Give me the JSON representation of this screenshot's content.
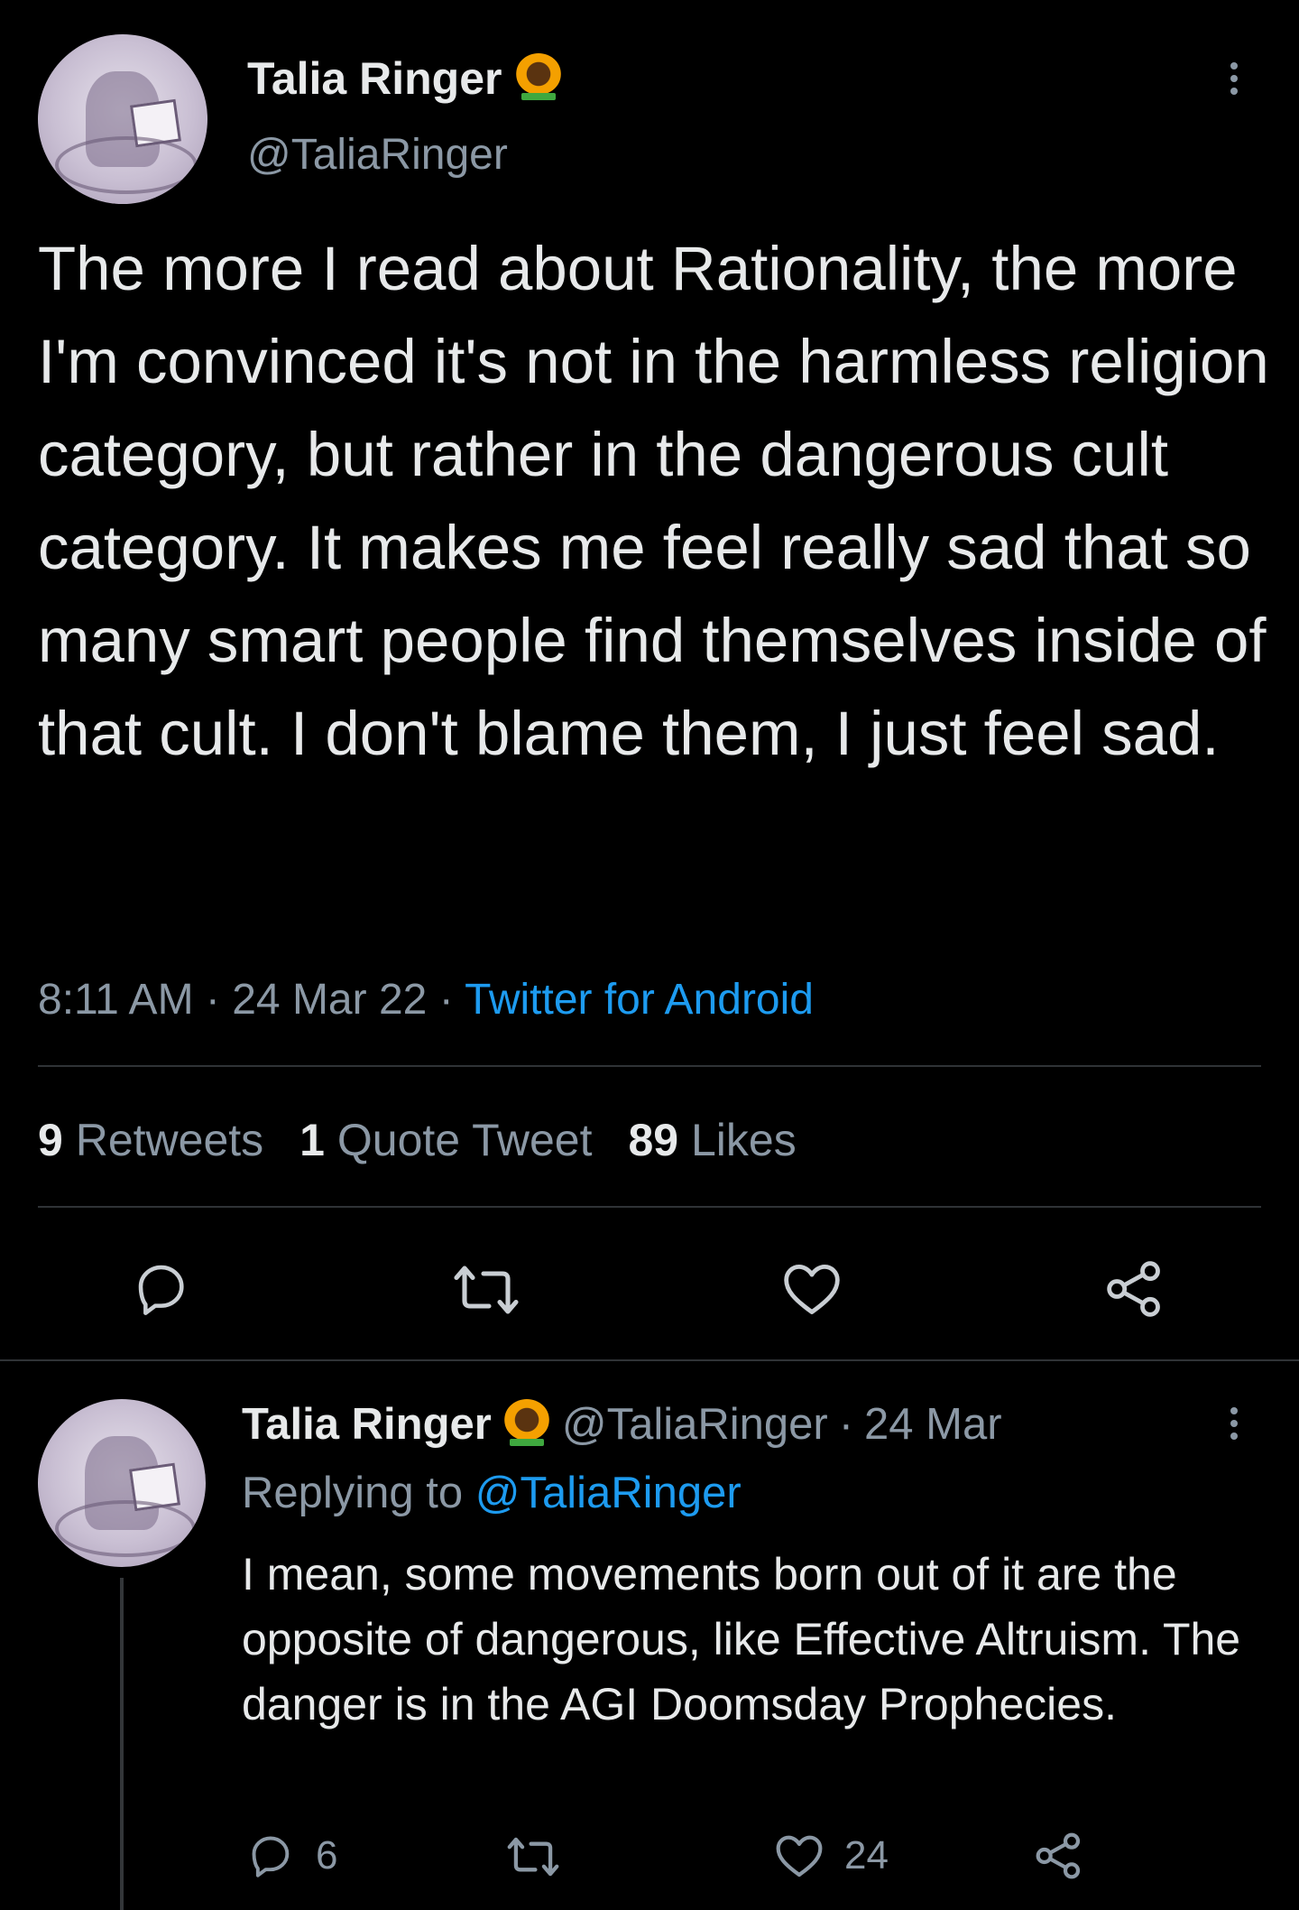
{
  "main_tweet": {
    "author_name": "Talia Ringer",
    "author_handle": "@TaliaRinger",
    "text": "The more I read about Rationality, the more I'm convinced it's not in the harmless religion category, but rather in the dangerous cult category. It makes me feel really sad that so many smart people find themselves inside of that cult. I don't blame them, I just feel sad.",
    "time": "8:11 AM",
    "sep1": "·",
    "date": "24 Mar 22",
    "sep2": "·",
    "source": "Twitter for Android",
    "retweets_count": "9",
    "retweets_label": "Retweets",
    "quotes_count": "1",
    "quotes_label": "Quote Tweet",
    "likes_count": "89",
    "likes_label": "Likes",
    "icons": [
      "reply-icon",
      "retweet-icon",
      "like-icon",
      "share-icon"
    ]
  },
  "reply_tweet": {
    "author_name": "Talia Ringer",
    "author_handle": "@TaliaRinger",
    "sep": "·",
    "date": "24 Mar",
    "replying_label": "Replying to",
    "replying_handle": "@TaliaRinger",
    "text": "I mean, some movements born out of it are the opposite of dangerous, like Effective Altruism. The danger is in the AGI Doomsday Prophecies.",
    "reply_count": "6",
    "like_count": "24"
  },
  "colors": {
    "background": "#000000",
    "text": "#e7e9ea",
    "secondary": "#8b98a5",
    "link": "#1d9bf0",
    "divider": "#2f3336"
  }
}
